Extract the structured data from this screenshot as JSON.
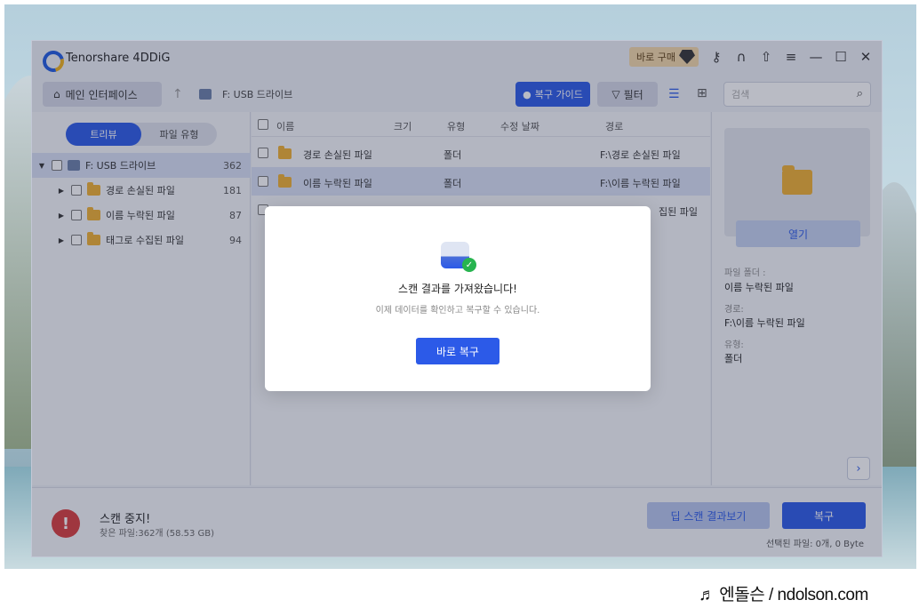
{
  "app": {
    "title": "Tenorshare 4DDiG",
    "buy_label": "바로 구매"
  },
  "nav": {
    "home_label": "메인 인터페이스",
    "drive_label": "F: USB 드라이브",
    "guide_label": "복구 가이드",
    "filter_label": "필터",
    "search_placeholder": "검색"
  },
  "sidebar": {
    "tabs": [
      "트리뷰",
      "파일 유형"
    ],
    "root": {
      "label": "F: USB 드라이브",
      "count": "362"
    },
    "items": [
      {
        "label": "경로 손실된 파일",
        "count": "181"
      },
      {
        "label": "이름 누락된 파일",
        "count": "87"
      },
      {
        "label": "태그로 수집된 파일",
        "count": "94"
      }
    ]
  },
  "table": {
    "columns": [
      "이름",
      "크기",
      "유형",
      "수정 날짜",
      "경로"
    ],
    "rows": [
      {
        "name": "경로 손실된 파일",
        "type": "폴더",
        "path": "F:\\경로 손실된 파일"
      },
      {
        "name": "이름 누락된 파일",
        "type": "폴더",
        "path": "F:\\이름 누락된 파일"
      },
      {
        "name": "",
        "type": "",
        "path": "...\\태그로 수집된 파일",
        "path_visible": "집된 파일"
      }
    ]
  },
  "preview": {
    "open_label": "열기",
    "folder_key": "파일 폴더 :",
    "folder_value": "이름 누락된 파일",
    "path_key": "경로:",
    "path_value": "F:\\이름 누락된 파일",
    "type_key": "유형:",
    "type_value": "폴더"
  },
  "footer": {
    "status_title": "스캔 중지!",
    "status_sub": "찾은 파일:362개 (58.53 GB)",
    "deep_scan_label": "딥 스캔 결과보기",
    "recover_label": "복구",
    "selection_info": "선택된 파일: 0개, 0 Byte"
  },
  "modal": {
    "title": "스캔 결과를 가져왔습니다!",
    "subtitle": "이제 데이터를 확인하고 복구할 수 있습니다.",
    "button_label": "바로 복구"
  },
  "watermark": "♬ 엔돌슨 / ndolson.com",
  "colors": {
    "accent": "#2c5ae8",
    "danger": "#d93b3b",
    "success": "#27b44f",
    "folder": "#f0b030"
  }
}
